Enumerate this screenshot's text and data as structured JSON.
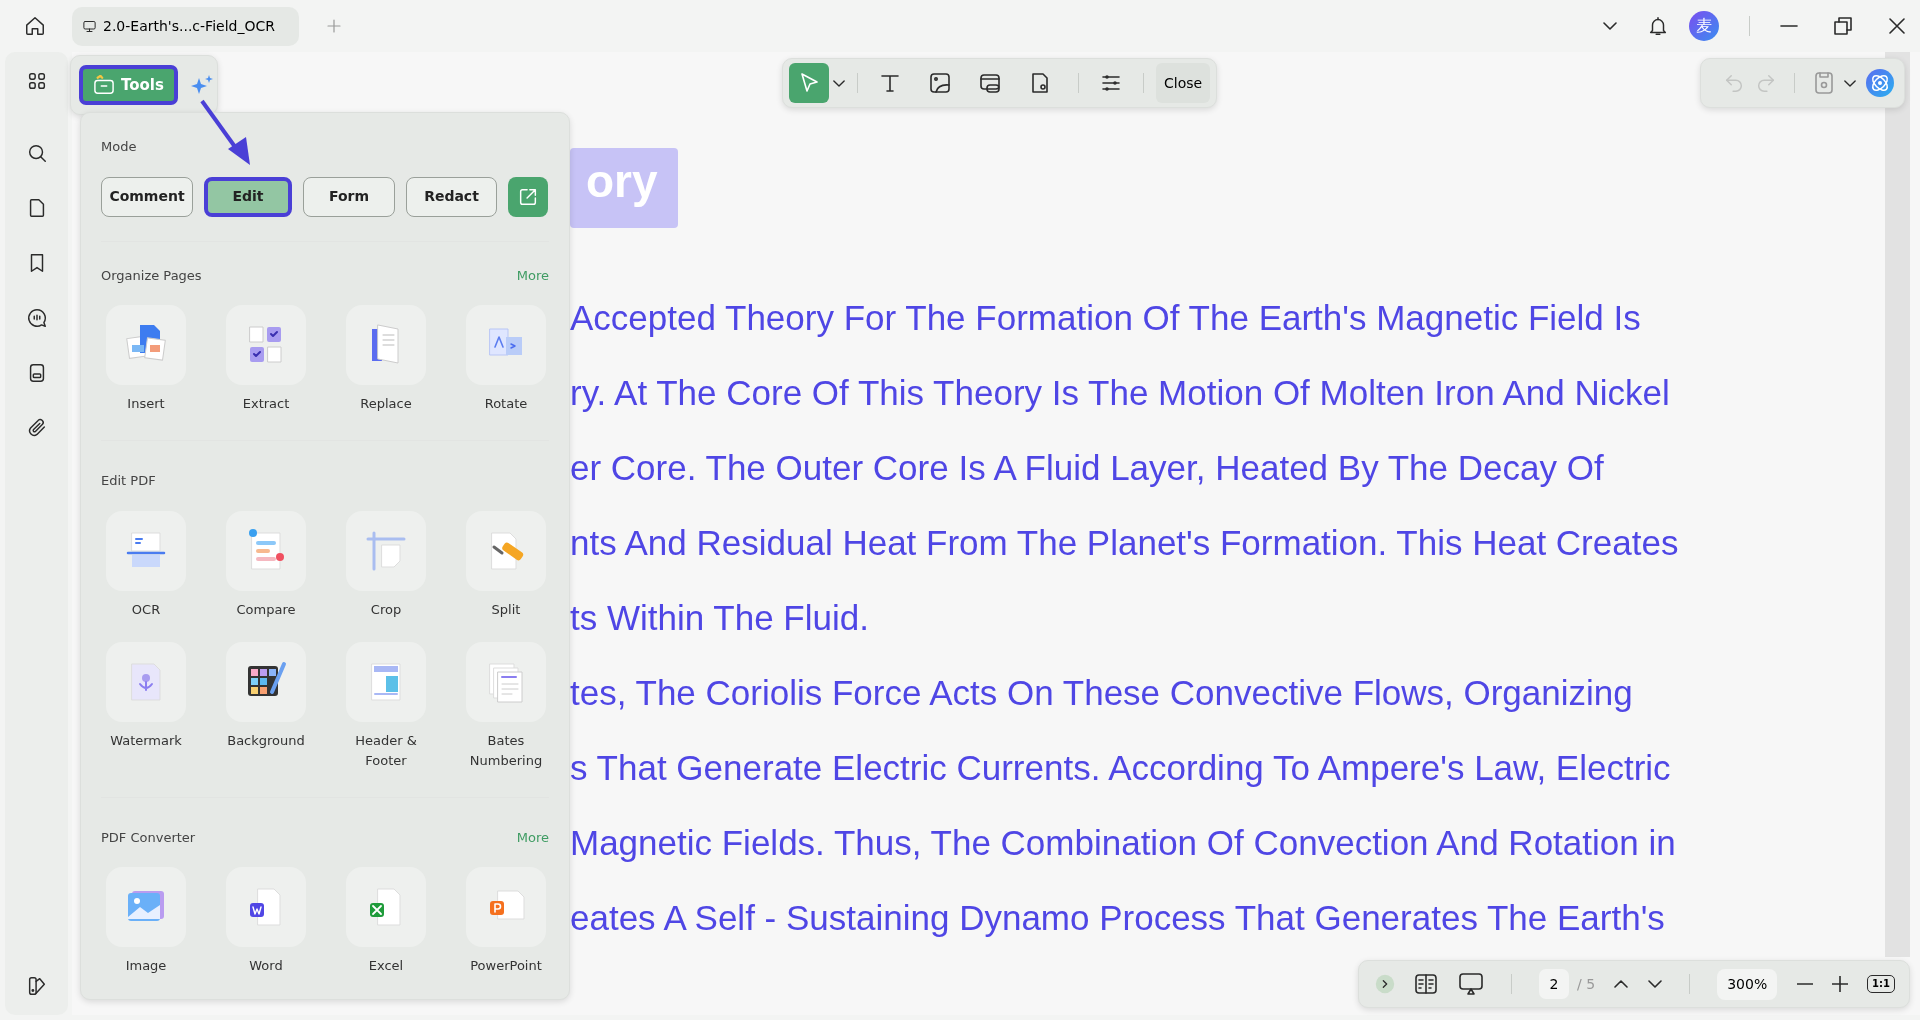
{
  "tab": {
    "title": "2.0-Earth's...c-Field_OCR"
  },
  "account": {
    "avatar": "麦"
  },
  "tools_button": {
    "label": "Tools",
    "highlighted": true
  },
  "edit_toolbar": {
    "tools": [
      {
        "kind": "select",
        "selected": true
      },
      {
        "kind": "text",
        "selected": false
      },
      {
        "kind": "image",
        "selected": false
      },
      {
        "kind": "link",
        "selected": false
      },
      {
        "kind": "stamp",
        "selected": false
      }
    ],
    "close": "Close"
  },
  "history": {
    "undo": {
      "disabled": true
    },
    "redo": {
      "disabled": true
    }
  },
  "tools_panel": {
    "mode_label": "Mode",
    "modes": [
      {
        "label": "Comment",
        "selected": false,
        "highlighted": false
      },
      {
        "label": "Edit",
        "selected": true,
        "highlighted": true
      },
      {
        "label": "Form",
        "selected": false,
        "highlighted": false
      },
      {
        "label": "Redact",
        "selected": false,
        "highlighted": false
      }
    ],
    "sections": [
      {
        "title": "Organize Pages",
        "more": "More",
        "items": [
          {
            "label": "Insert",
            "kind": "insert"
          },
          {
            "label": "Extract",
            "kind": "extract"
          },
          {
            "label": "Replace",
            "kind": "replace"
          },
          {
            "label": "Rotate",
            "kind": "rotate"
          }
        ]
      },
      {
        "title": "Edit PDF",
        "items": [
          {
            "label": "OCR",
            "kind": "ocr"
          },
          {
            "label": "Compare",
            "kind": "compare"
          },
          {
            "label": "Crop",
            "kind": "crop"
          },
          {
            "label": "Split",
            "kind": "split"
          },
          {
            "label": "Watermark",
            "kind": "watermark"
          },
          {
            "label": "Background",
            "kind": "background"
          },
          {
            "label": "Header & Footer",
            "kind": "header"
          },
          {
            "label": "Bates Numbering",
            "kind": "bates"
          }
        ]
      },
      {
        "title": "PDF Converter",
        "more": "More",
        "items": [
          {
            "label": "Image",
            "kind": "image"
          },
          {
            "label": "Word",
            "kind": "word"
          },
          {
            "label": "Excel",
            "kind": "excel"
          },
          {
            "label": "PowerPoint",
            "kind": "powerpoint"
          }
        ]
      }
    ]
  },
  "document": {
    "heading": "ory",
    "lines": [
      "Accepted Theory For The Formation Of The Earth's Magnetic Field Is",
      "ry. At The Core Of This Theory Is The Motion Of Molten Iron And Nickel",
      "er Core. The Outer Core Is A Fluid Layer, Heated By The Decay Of",
      "nts And Residual Heat From The Planet's Formation. This Heat Creates",
      "ts Within The Fluid.",
      "tes, The Coriolis Force Acts On These Convective Flows, Organizing",
      "s That Generate Electric Currents. According To Ampere's Law, Electric",
      "Magnetic Fields. Thus, The Combination Of Convection And Rotation in",
      "eates A Self - Sustaining Dynamo Process That Generates The Earth's"
    ]
  },
  "navigation": {
    "page": "2",
    "total": "/ 5",
    "zoom": "300%",
    "actual_size": "1:1"
  }
}
